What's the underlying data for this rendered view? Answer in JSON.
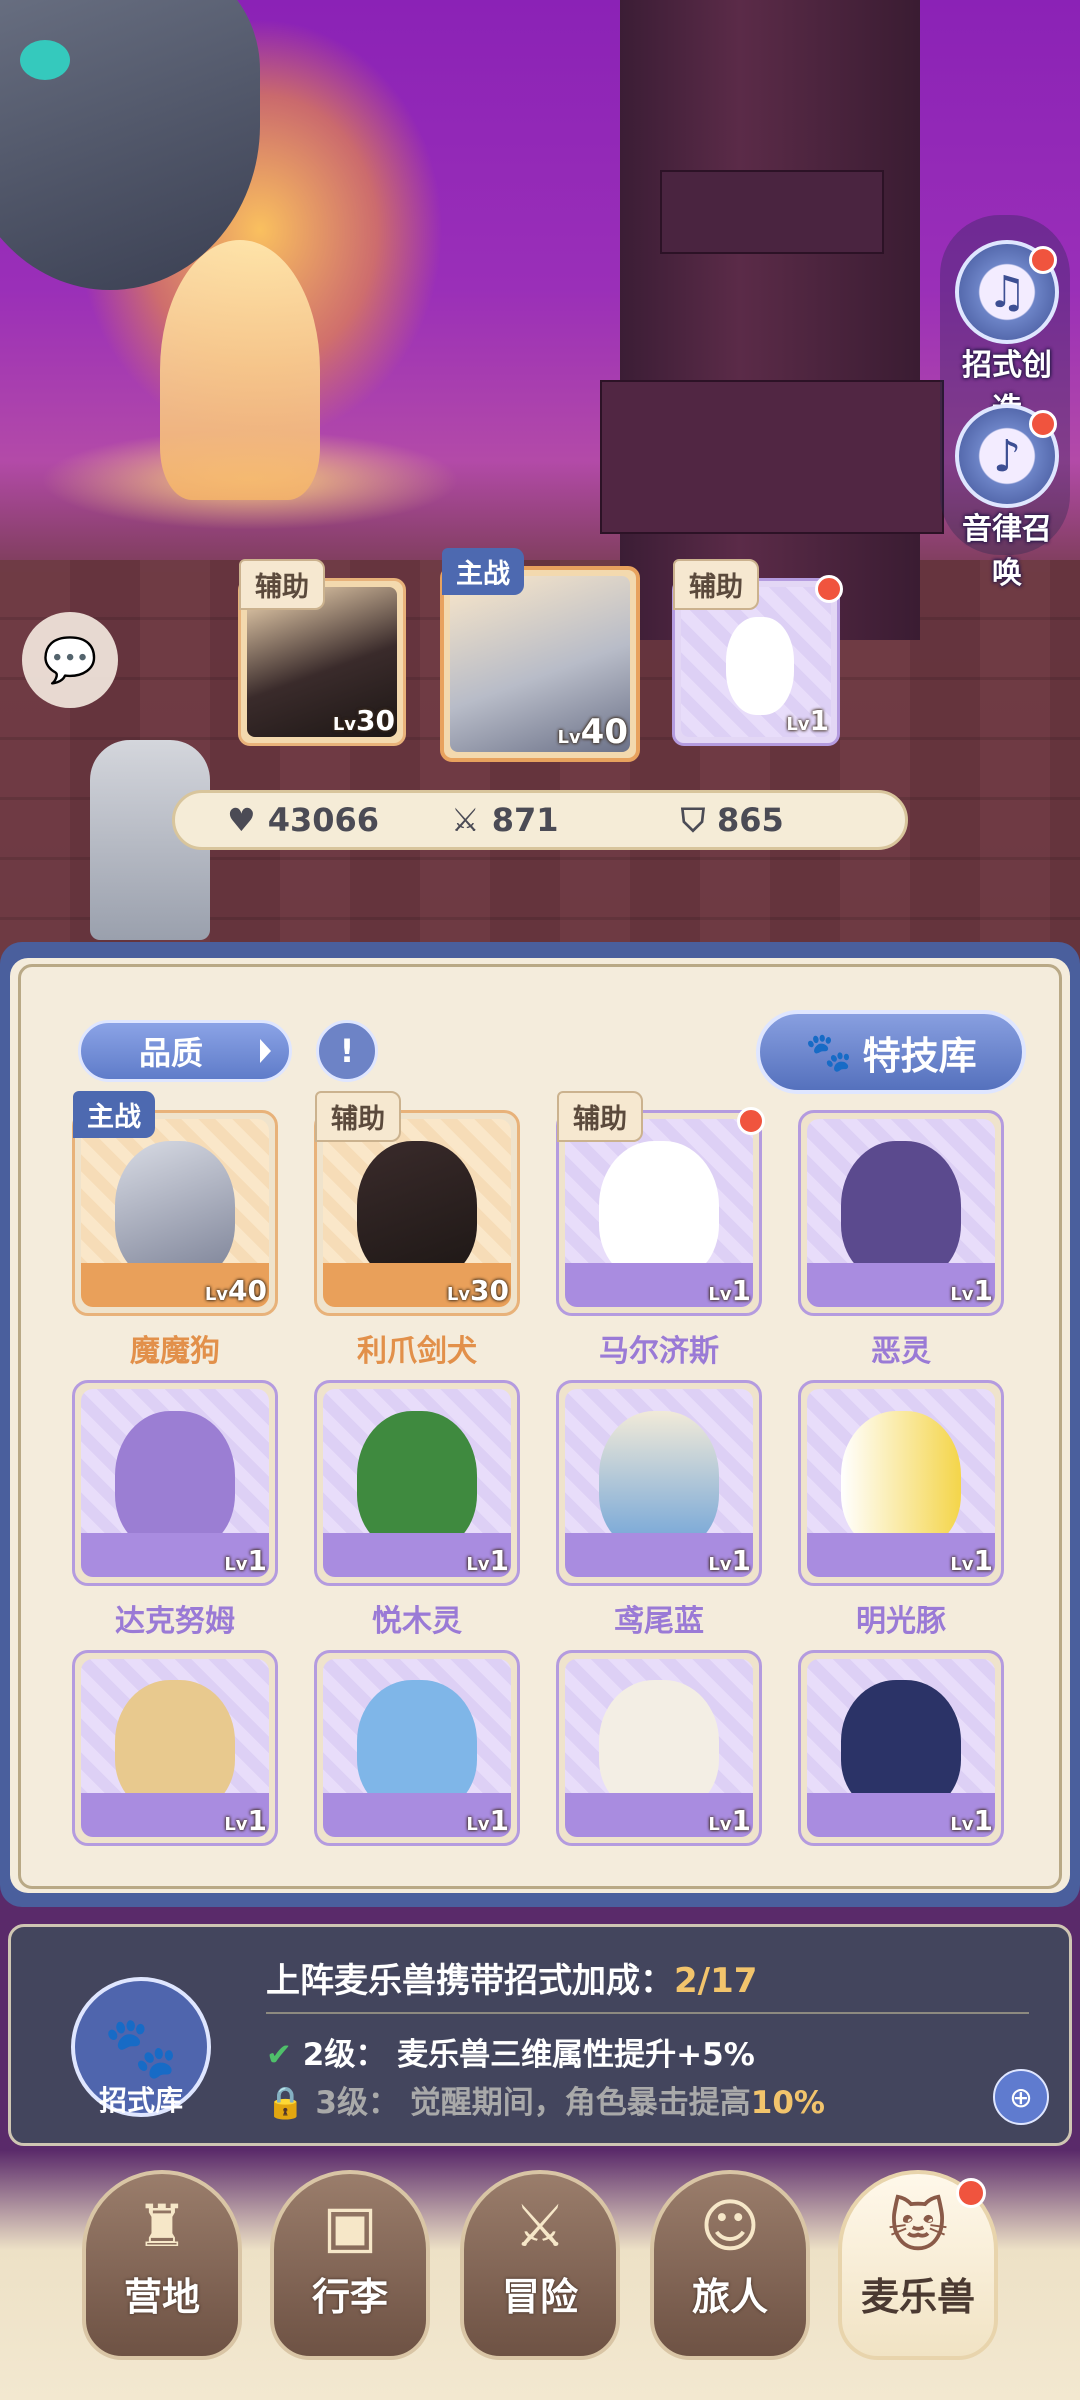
{
  "side_buttons": [
    {
      "label": "招式创造",
      "icon": "music-book-icon"
    },
    {
      "label": "音律召唤",
      "icon": "lyre-icon"
    }
  ],
  "team": {
    "slots": [
      {
        "tag": "辅助",
        "level": "30",
        "name": "利爪剑犬"
      },
      {
        "tag": "主战",
        "level": "40",
        "name": "魔魔狗"
      },
      {
        "tag": "辅助",
        "level": "1",
        "name": "马尔济斯"
      }
    ],
    "lv_prefix": "Lv"
  },
  "stats": {
    "hp": "43066",
    "attack": "871",
    "defense": "865"
  },
  "filter": {
    "quality_label": "品质",
    "info_icon": "!",
    "skill_library_label": "特技库"
  },
  "pets": [
    {
      "name": "魔魔狗",
      "level": "40",
      "tag": "主战",
      "color": "orange"
    },
    {
      "name": "利爪剑犬",
      "level": "30",
      "tag": "辅助",
      "color": "orange"
    },
    {
      "name": "马尔济斯",
      "level": "1",
      "tag": "辅助",
      "color": "purple"
    },
    {
      "name": "恶灵",
      "level": "1",
      "tag": "",
      "color": "purple"
    },
    {
      "name": "达克努姆",
      "level": "1",
      "tag": "",
      "color": "purple"
    },
    {
      "name": "悦木灵",
      "level": "1",
      "tag": "",
      "color": "purple"
    },
    {
      "name": "鸢尾蓝",
      "level": "1",
      "tag": "",
      "color": "purple"
    },
    {
      "name": "明光豚",
      "level": "1",
      "tag": "",
      "color": "purple"
    },
    {
      "name": "",
      "level": "1",
      "tag": "",
      "color": "purple"
    },
    {
      "name": "",
      "level": "1",
      "tag": "",
      "color": "purple"
    },
    {
      "name": "",
      "level": "1",
      "tag": "",
      "color": "purple"
    },
    {
      "name": "",
      "level": "1",
      "tag": "",
      "color": "purple"
    }
  ],
  "bonus": {
    "library_label": "招式库",
    "title": "上阵麦乐兽携带招式加成：",
    "progress": "2/17",
    "rows": [
      {
        "level": "2级：",
        "text": "麦乐兽三维属性提升+5%",
        "unlocked": true
      },
      {
        "level": "3级：",
        "text_before": "觉醒期间，角色暴击提高",
        "highlight": "10%",
        "unlocked": false
      }
    ]
  },
  "nav": [
    {
      "label": "营地",
      "icon": "castle-icon"
    },
    {
      "label": "行李",
      "icon": "backpack-icon"
    },
    {
      "label": "冒险",
      "icon": "crossed-swords-icon"
    },
    {
      "label": "旅人",
      "icon": "traveler-icon"
    },
    {
      "label": "麦乐兽",
      "icon": "pet-icon",
      "active": true
    }
  ],
  "colors": {
    "panel_blue": "#4a5f9d",
    "panel_cream": "#f4ecdc",
    "gold": "#f2c46c",
    "red_dot": "#f0543e"
  }
}
